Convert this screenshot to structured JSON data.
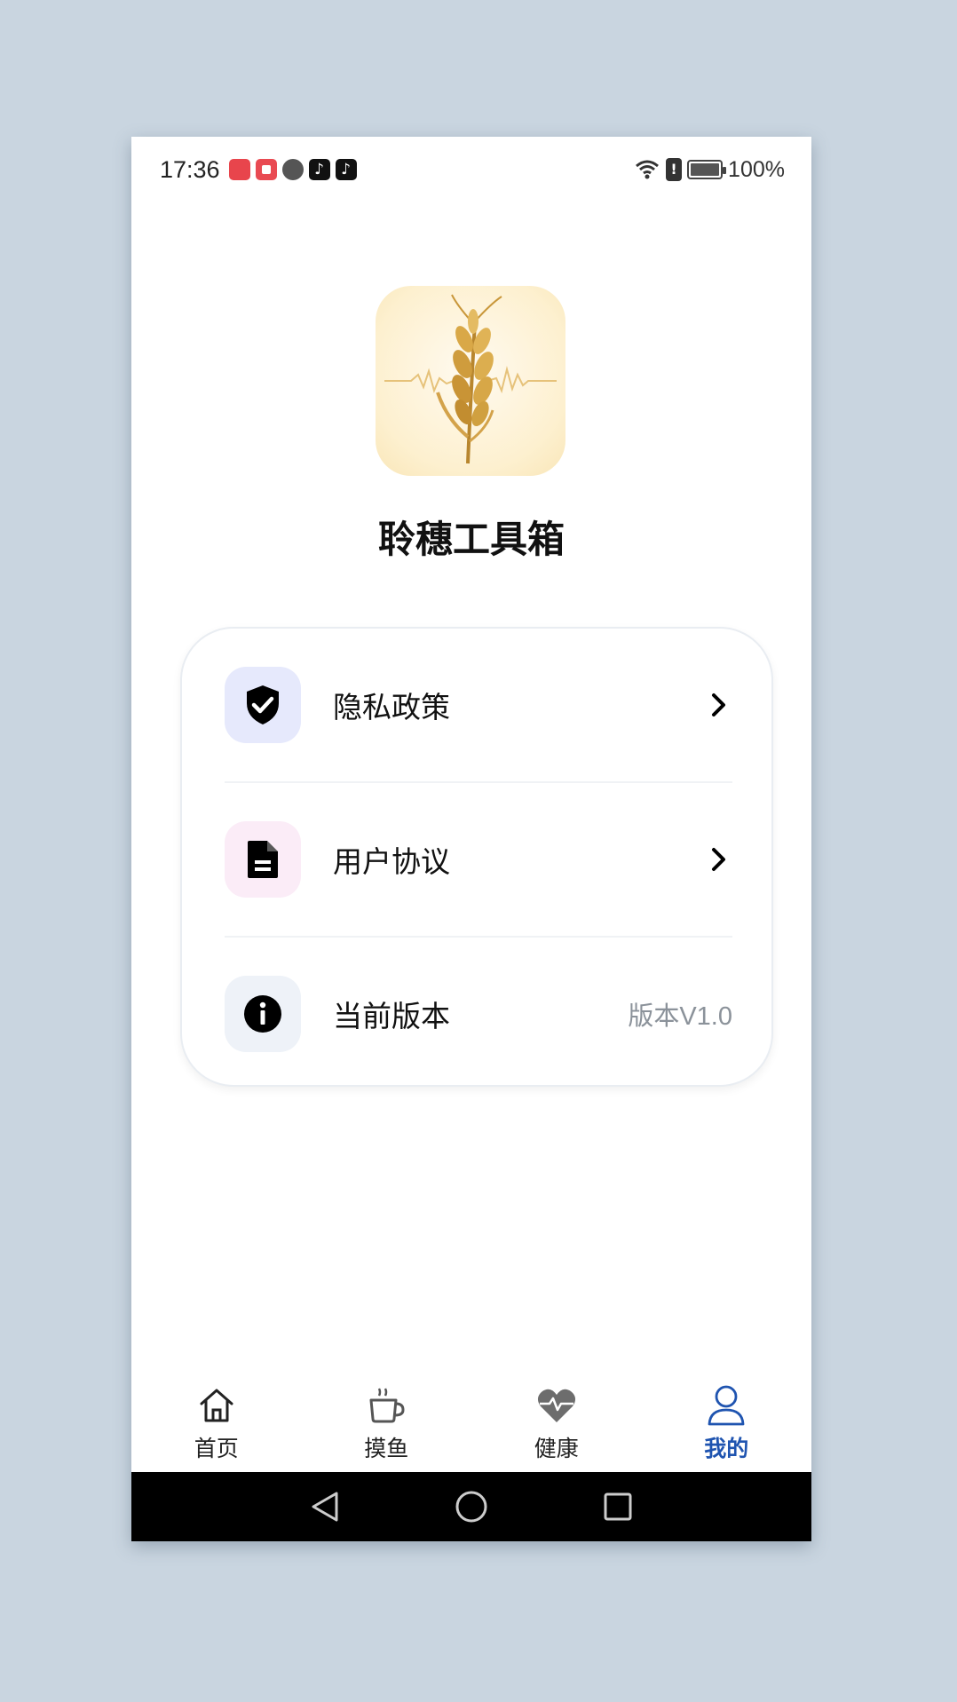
{
  "status_bar": {
    "time": "17:36",
    "battery_percent": "100%",
    "battery_level": 1.0,
    "notification_icons": [
      "huawei-store-icon",
      "reader-icon",
      "browser-icon",
      "tiktok-icon",
      "tiktok-icon"
    ]
  },
  "app": {
    "name": "聆穗工具箱",
    "logo_icon": "wheat-soundwave-logo"
  },
  "menu": {
    "items": [
      {
        "label": "隐私政策",
        "icon": "shield-check-icon",
        "icon_bg": "#e6e9fc",
        "trailing": "chevron-right-icon"
      },
      {
        "label": "用户协议",
        "icon": "document-icon",
        "icon_bg": "#fbecf7",
        "trailing": "chevron-right-icon"
      },
      {
        "label": "当前版本",
        "icon": "info-icon",
        "icon_bg": "#eef2f8",
        "value": "版本V1.0"
      }
    ]
  },
  "tabbar": {
    "tabs": [
      {
        "label": "首页",
        "icon": "home-icon",
        "active": false
      },
      {
        "label": "摸鱼",
        "icon": "coffee-cup-icon",
        "active": false
      },
      {
        "label": "健康",
        "icon": "heart-pulse-icon",
        "active": false
      },
      {
        "label": "我的",
        "icon": "user-icon",
        "active": true
      }
    ],
    "active_color": "#1f54b0"
  },
  "system_nav": {
    "buttons": [
      "back-triangle-icon",
      "home-circle-icon",
      "recents-square-icon"
    ]
  }
}
